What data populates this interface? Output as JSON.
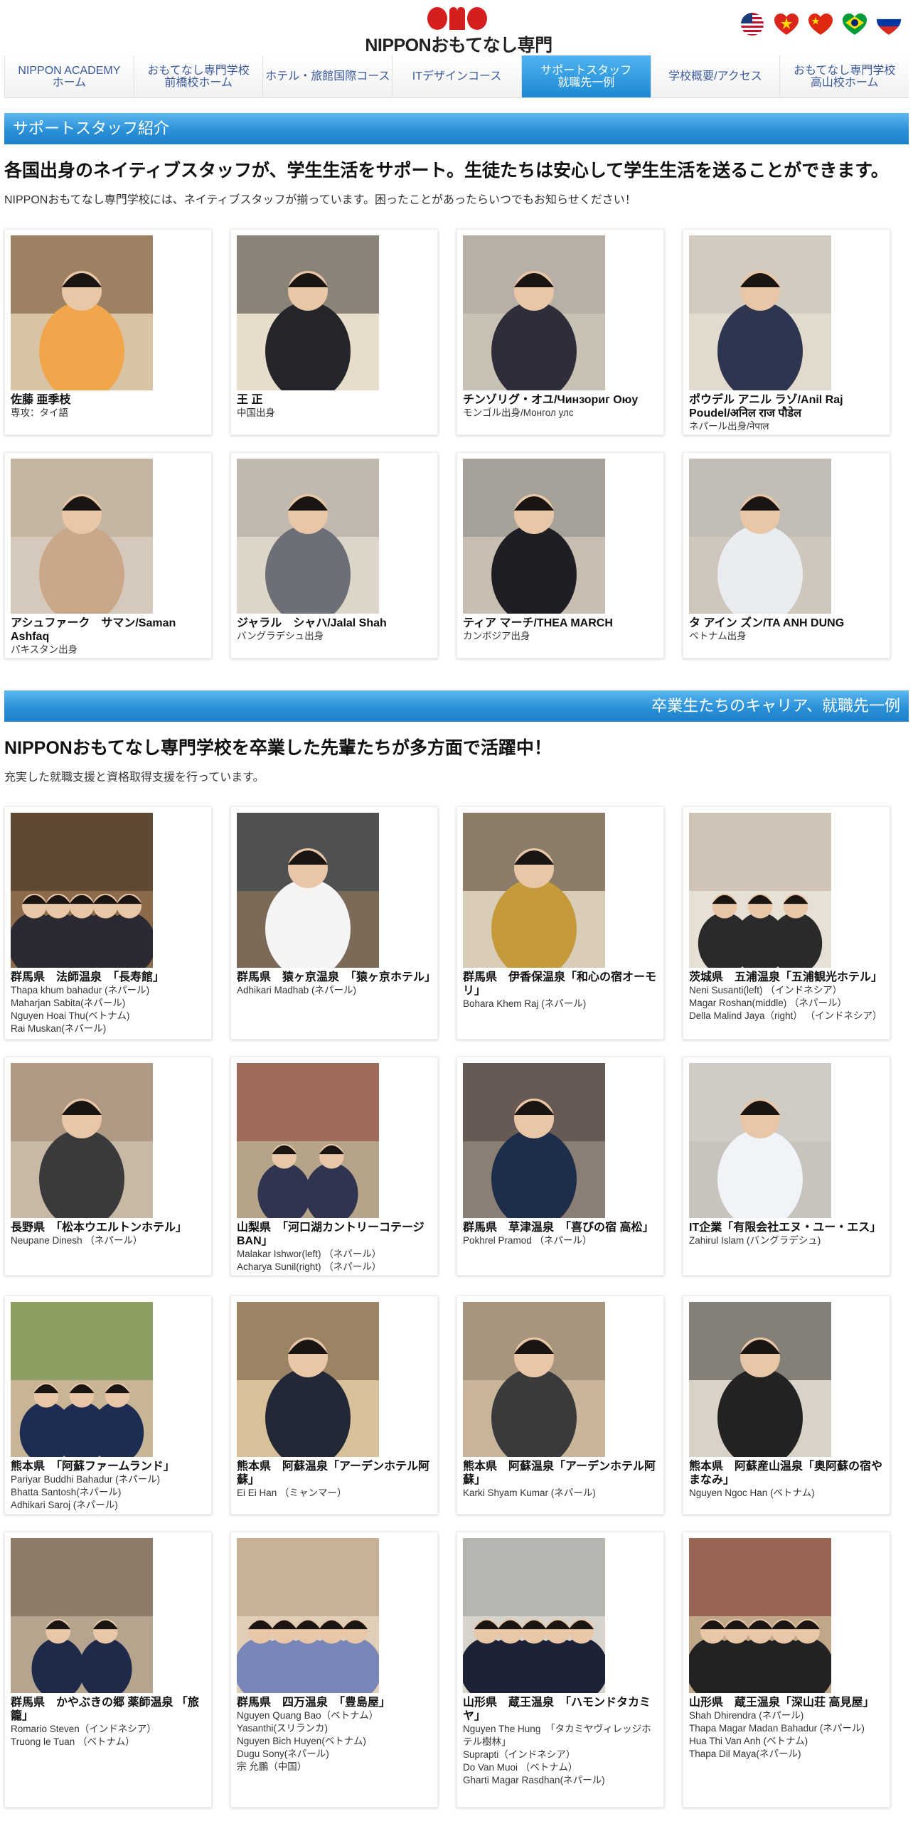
{
  "header": {
    "logo_mark": "omo",
    "logo_text": "NIPPONおもてなし専門学校",
    "flags": [
      {
        "name": "usa-flag"
      },
      {
        "name": "vietnam-flag"
      },
      {
        "name": "china-flag"
      },
      {
        "name": "brazil-flag"
      },
      {
        "name": "russia-flag"
      }
    ]
  },
  "nav": {
    "items": [
      {
        "label": "NIPPON ACADEMY\nホーム",
        "active": false
      },
      {
        "label": "おもてなし専門学校\n前橋校ホーム",
        "active": false
      },
      {
        "label": "ホテル・旅館国際コース",
        "active": false
      },
      {
        "label": "ITデザインコース",
        "active": false
      },
      {
        "label": "サポートスタッフ\n就職先一例",
        "active": true
      },
      {
        "label": "学校概要/アクセス",
        "active": false
      },
      {
        "label": "おもてなし専門学校\n高山校ホーム",
        "active": false
      }
    ]
  },
  "staff_section": {
    "bar_title": "サポートスタッフ紹介",
    "heading": "各国出身のネイティブスタッフが、学生生活をサポート。生徒たちは安心して学生生活を送ることができます。",
    "lead": "NIPPONおもてなし専門学校には、ネイティブスタッフが揃っています。困ったことがあったらいつでもお知らせください！",
    "cards": [
      {
        "name": "佐藤 亜季枝",
        "sub": [
          "専攻：タイ語"
        ]
      },
      {
        "name": "王 正",
        "sub": [
          "中国出身"
        ]
      },
      {
        "name": "チンゾリグ・オユ/Чинзориг Оюу",
        "sub": [
          "モンゴル出身/Монгол улс"
        ]
      },
      {
        "name": "ポウデル アニル ラゾ/Anil Raj Poudel/अनिल राज पौडेल",
        "sub": [
          "ネパール出身/नेपाल"
        ]
      },
      {
        "name": "アシュファーク　サマン/Saman Ashfaq",
        "sub": [
          "パキスタン出身"
        ]
      },
      {
        "name": "ジャラル　シャハ/Jalal Shah",
        "sub": [
          "バングラデシュ出身"
        ]
      },
      {
        "name": "ティア マーチ/THEA MARCH",
        "sub": [
          "カンボジア出身"
        ]
      },
      {
        "name": "タ アイン ズン/TA ANH DUNG",
        "sub": [
          "ベトナム出身"
        ]
      }
    ]
  },
  "career_section": {
    "bar_title": "卒業生たちのキャリア、就職先一例",
    "heading": "NIPPONおもてなし専門学校を卒業した先輩たちが多方面で活躍中！",
    "lead": "充実した就職支援と資格取得支援を行っています。",
    "cards": [
      {
        "name": "群馬県　法師温泉　「長寿館」",
        "sub": [
          "Thapa khum bahadur (ネパール)",
          "Maharjan Sabita(ネパール)",
          "Nguyen Hoai Thu(ベトナム)",
          "Rai Muskan(ネパール)"
        ]
      },
      {
        "name": "群馬県　猿ヶ京温泉　「猿ヶ京ホテル」",
        "sub": [
          "Adhikari Madhab (ネパール)"
        ]
      },
      {
        "name": "群馬県　伊香保温泉「和心の宿オーモリ」",
        "sub": [
          "Bohara Khem Raj (ネパール)"
        ]
      },
      {
        "name": "茨城県　五浦温泉「五浦観光ホテル」",
        "sub": [
          "Neni Susanti(left) （インドネシア）",
          "Magar Roshan(middle) （ネパール）",
          "Della Malind Jaya（right） （インドネシア）"
        ]
      },
      {
        "name": "長野県　「松本ウエルトンホテル」",
        "sub": [
          "Neupane Dinesh （ネパール）"
        ]
      },
      {
        "name": "山梨県　「河口湖カントリーコテージBAN」",
        "sub": [
          "Malakar Ishwor(left) （ネパール）",
          "Acharya Sunil(right) （ネパール）"
        ]
      },
      {
        "name": "群馬県　草津温泉　「喜びの宿 高松」",
        "sub": [
          "Pokhrel Pramod （ネパール）"
        ]
      },
      {
        "name": "IT企業「有限会社エヌ・ユー・エス」",
        "sub": [
          "Zahirul Islam (バングラデシュ)"
        ]
      },
      {
        "name": "熊本県　「阿蘇ファームランド」",
        "sub": [
          "Pariyar Buddhi Bahadur (ネパール)",
          "Bhatta Santosh(ネパール)",
          "Adhikari Saroj (ネパール)"
        ]
      },
      {
        "name": "熊本県　阿蘇温泉「アーデンホテル阿蘇」",
        "sub": [
          "Ei Ei Han （ミャンマー）"
        ]
      },
      {
        "name": "熊本県　阿蘇温泉「アーデンホテル阿蘇」",
        "sub": [
          "Karki Shyam Kumar (ネパール)"
        ]
      },
      {
        "name": "熊本県　阿蘇産山温泉「奥阿蘇の宿やまなみ」",
        "sub": [
          "Nguyen Ngoc Han (ベトナム)"
        ]
      },
      {
        "name": "群馬県　かやぶきの郷 薬師温泉 「旅籠」",
        "sub": [
          "Romario Steven（インドネシア）",
          "Truong le Tuan （ベトナム）"
        ]
      },
      {
        "name": "群馬県　四万温泉　「豊島屋」",
        "sub": [
          "Nguyen Quang Bao（ベトナム）",
          "Yasanthi(スリランカ)",
          "Nguyen Bich Huyen(ベトナム)",
          "Dugu Sony(ネパール)",
          "宗 允鵬（中国）"
        ]
      },
      {
        "name": "山形県　蔵王温泉　「ハモンドタカミヤ」",
        "sub": [
          "Nguyen The Hung　「タカミヤヴィレッジホテル樹林」",
          "Suprapti（インドネシア）",
          "Do Van Muoi （ベトナム）",
          "Gharti Magar Rasdhan(ネパール)"
        ]
      },
      {
        "name": "山形県　蔵王温泉「深山荘 高見屋」",
        "sub": [
          "Shah Dhirendra (ネパール)",
          "Thapa Magar Madan Bahadur (ネパール)",
          "Hua Thi Van Anh (ベトナム)",
          "Thapa Dil Maya(ネパール)"
        ]
      }
    ]
  },
  "colors": {
    "accent_blue": "#1f8ad6",
    "nav_text": "#3a5a9b",
    "logo_red": "#d51f1f"
  }
}
